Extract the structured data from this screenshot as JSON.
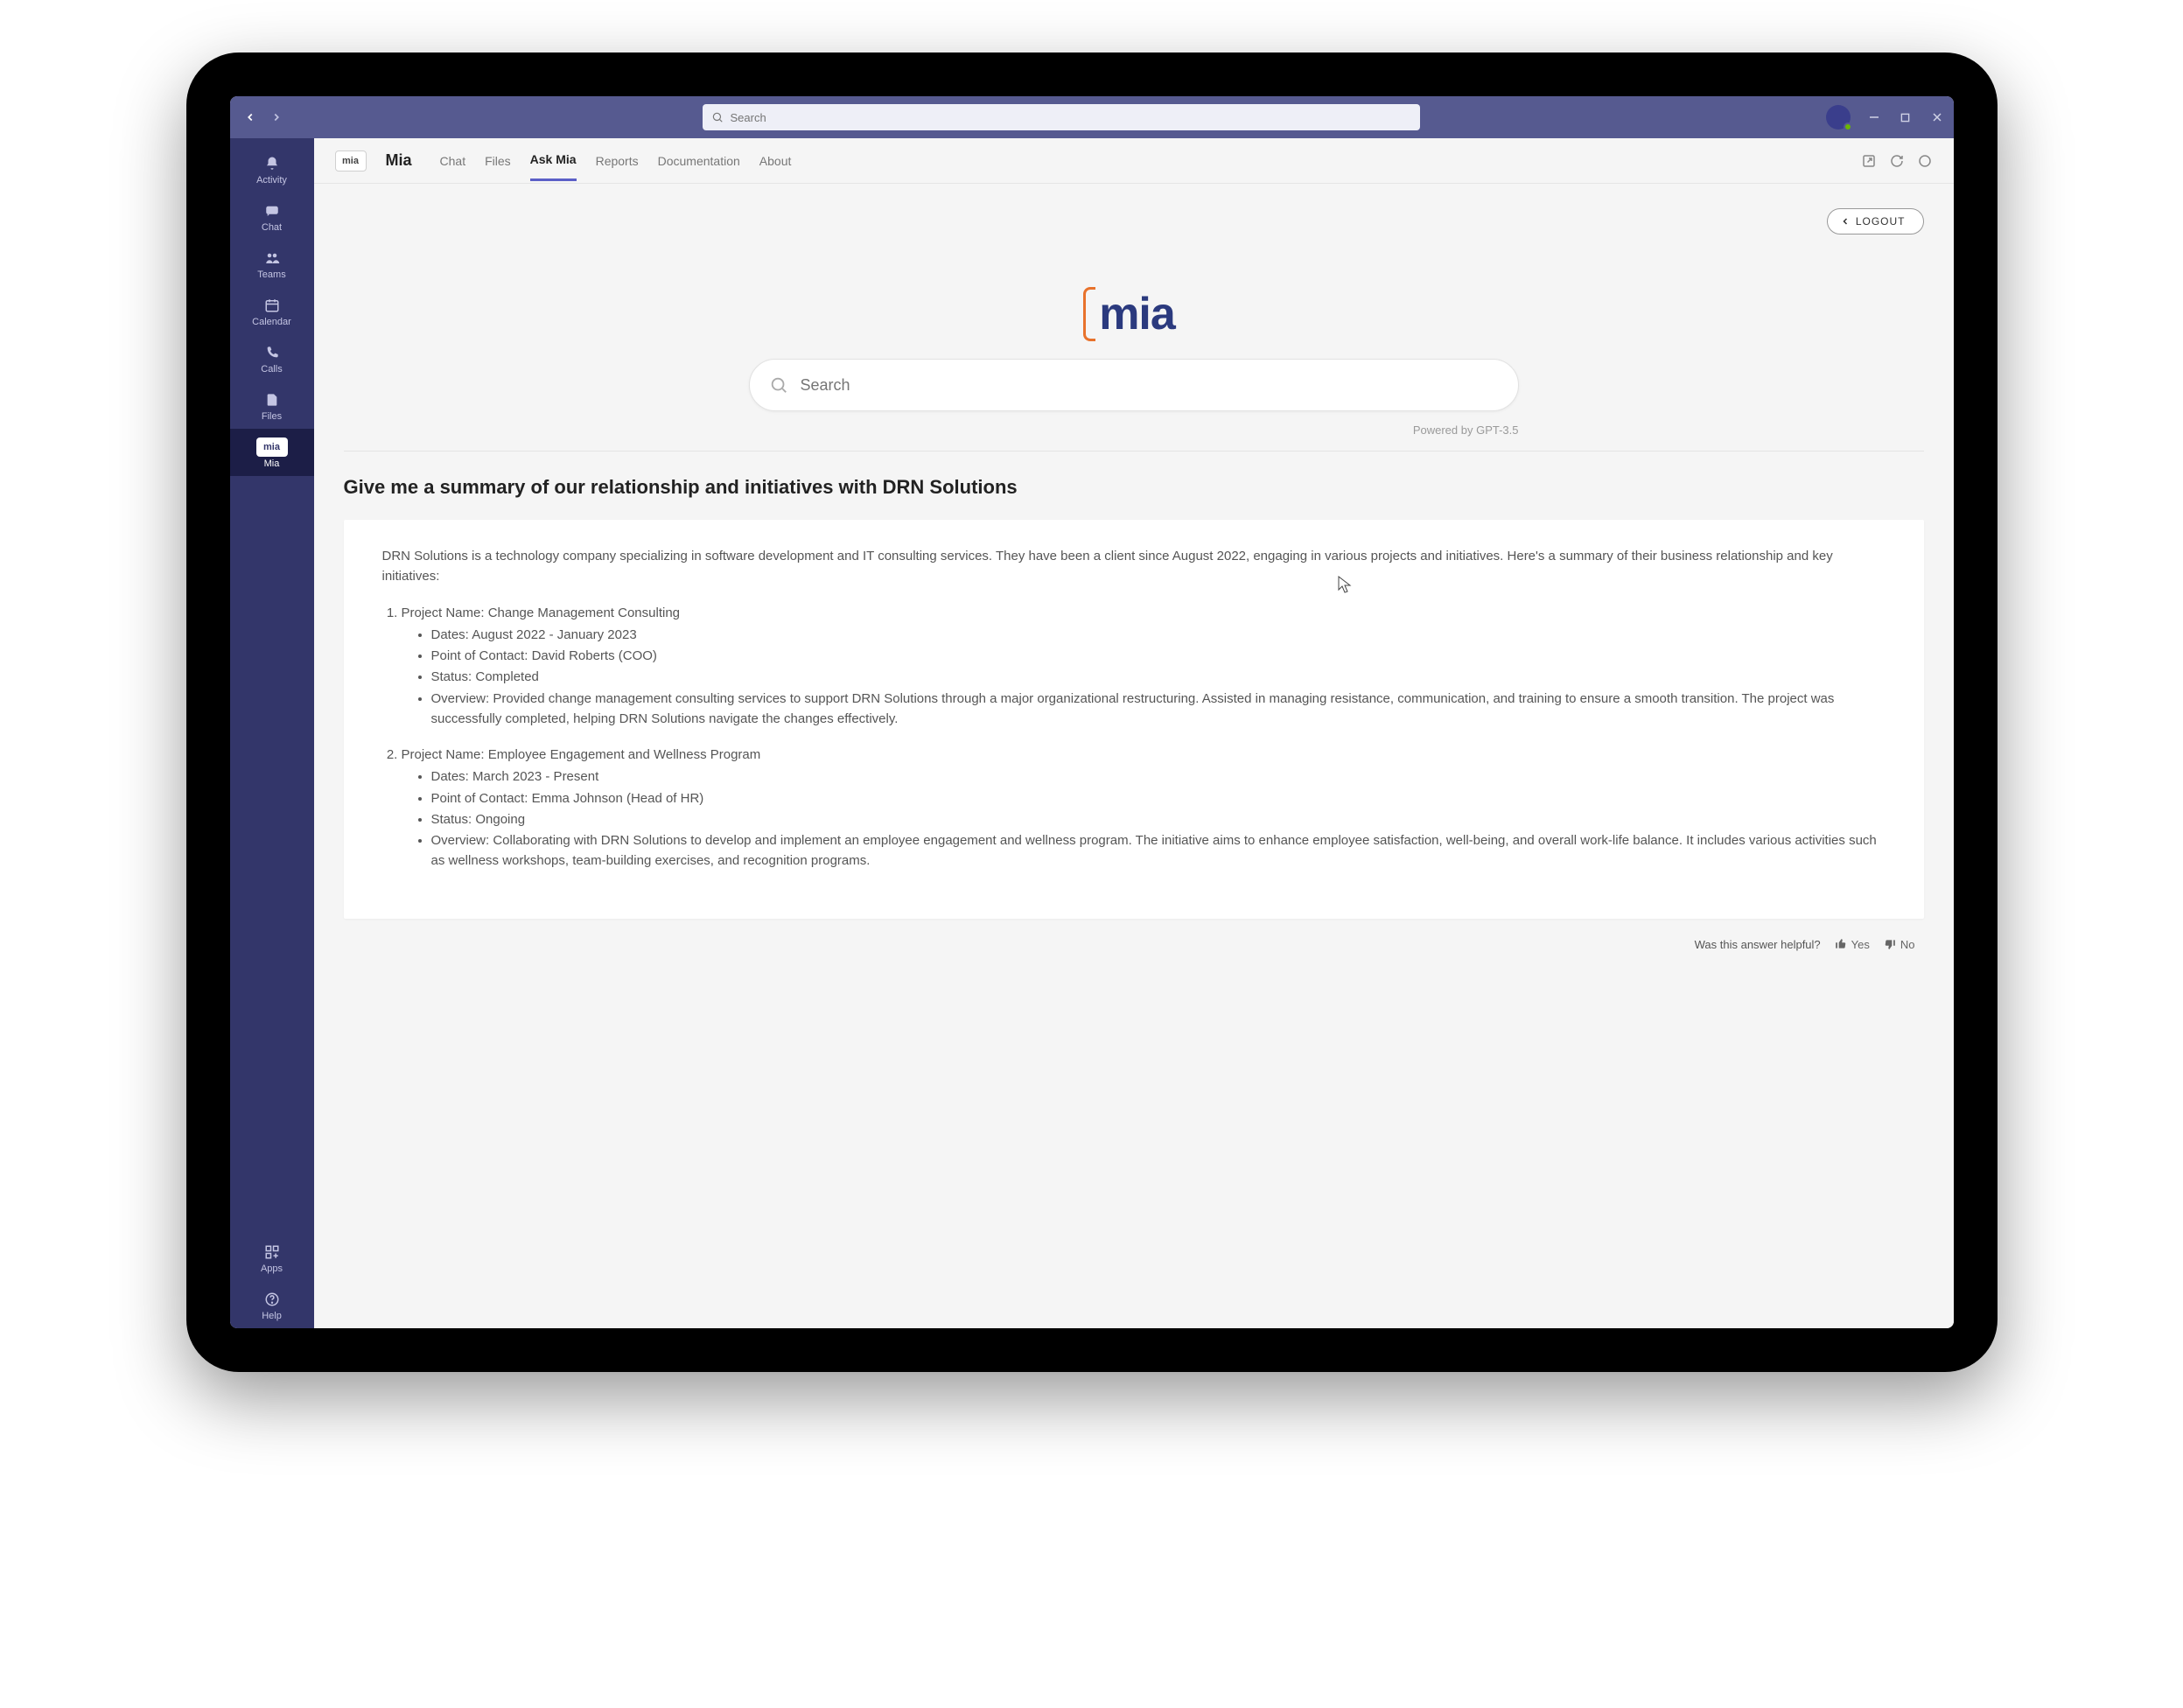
{
  "titlebar": {
    "search_placeholder": "Search"
  },
  "rail": {
    "activity": "Activity",
    "chat": "Chat",
    "teams": "Teams",
    "calendar": "Calendar",
    "calls": "Calls",
    "files": "Files",
    "mia": "Mia",
    "apps": "Apps",
    "help": "Help",
    "mia_badge": "mia"
  },
  "app": {
    "badge": "mia",
    "title": "Mia",
    "tabs": {
      "chat": "Chat",
      "files": "Files",
      "askmia": "Ask Mia",
      "reports": "Reports",
      "documentation": "Documentation",
      "about": "About"
    }
  },
  "logout_label": "LOGOUT",
  "hero": {
    "logo_text": "mia",
    "search_placeholder": "Search",
    "powered": "Powered by GPT-3.5"
  },
  "prompt": "Give me a summary of our relationship and initiatives with DRN Solutions",
  "answer": {
    "intro": "DRN Solutions is a technology company specializing in software development and IT consulting services. They have been a client since August 2022, engaging in various projects and initiatives. Here's a summary of their business relationship and key initiatives:",
    "items": [
      {
        "title": "Project Name: Change Management Consulting",
        "bullets": [
          "Dates: August 2022 - January 2023",
          "Point of Contact: David Roberts (COO)",
          "Status: Completed",
          "Overview: Provided change management consulting services to support DRN Solutions through a major organizational restructuring. Assisted in managing resistance, communication, and training to ensure a smooth transition. The project was successfully completed, helping DRN Solutions navigate the changes effectively."
        ]
      },
      {
        "title": "Project Name: Employee Engagement and Wellness Program",
        "bullets": [
          "Dates: March 2023 - Present",
          "Point of Contact: Emma Johnson (Head of HR)",
          "Status: Ongoing",
          "Overview: Collaborating with DRN Solutions to develop and implement an employee engagement and wellness program. The initiative aims to enhance employee satisfaction, well-being, and overall work-life balance. It includes various activities such as wellness workshops, team-building exercises, and recognition programs."
        ]
      }
    ]
  },
  "feedback": {
    "question": "Was this answer helpful?",
    "yes": "Yes",
    "no": "No"
  }
}
